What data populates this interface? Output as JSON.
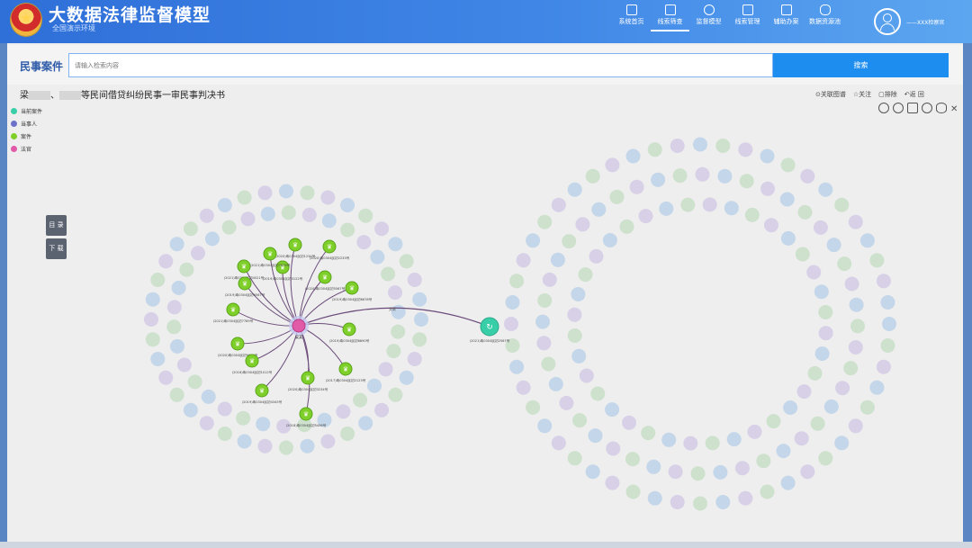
{
  "app": {
    "title": "大数据法律监督模型",
    "subtitle": "全国演示环境"
  },
  "nav": {
    "items": [
      {
        "label": "系统首页",
        "icon": "home-icon"
      },
      {
        "label": "线索筛查",
        "icon": "search-doc-icon",
        "active": true
      },
      {
        "label": "监督模型",
        "icon": "globe-icon"
      },
      {
        "label": "线索管理",
        "icon": "doc-icon"
      },
      {
        "label": "辅助办案",
        "icon": "grid-icon"
      },
      {
        "label": "数据资源池",
        "icon": "database-icon"
      }
    ]
  },
  "user": {
    "name": "XXX检察官"
  },
  "search": {
    "category": "民事案件",
    "placeholder": "请输入检索内容",
    "button": "搜索"
  },
  "case": {
    "title_prefix": "梁",
    "title_mid": "、",
    "title_suffix": "等民间借贷纠纷民事一审民事判决书"
  },
  "actions": {
    "related": "关联图谱",
    "follow": "关注",
    "exclude": "排除",
    "back": "返 回"
  },
  "legend": [
    {
      "label": "当前案件",
      "color": "#38cfa8"
    },
    {
      "label": "当事人",
      "color": "#6c72c9"
    },
    {
      "label": "案件",
      "color": "#7fcf2a"
    },
    {
      "label": "法官",
      "color": "#e05aa8"
    }
  ],
  "side": {
    "catalog": "目 录",
    "download": "下 载"
  },
  "graph": {
    "center_label": "梁某",
    "current_case_label": "(2021)粤0304民初2567号",
    "case_nodes": [
      {
        "label": "(2020)粤0304民初1234号"
      },
      {
        "label": "(2020)粤0304民初2233号"
      },
      {
        "label": "(2019)粤0304民初3122号"
      },
      {
        "label": "(2021)粤0304民初4521号"
      },
      {
        "label": "(2020)粤0304民初5567号"
      },
      {
        "label": "(2019)粤0304民初6678号"
      },
      {
        "label": "(2021)粤0304民初7789号"
      },
      {
        "label": "(2019)粤0304民初8890号"
      },
      {
        "label": "(2020)粤0304民初9901号"
      },
      {
        "label": "(2018)粤0304民初1012号"
      },
      {
        "label": "(2017)粤0304民初2123号"
      },
      {
        "label": "(2020)粤0304民初3234号"
      },
      {
        "label": "(2019)粤0304民初4345号"
      },
      {
        "label": "(2018)粤0304民初5456号"
      },
      {
        "label": "(2019)粤0304民初6567号"
      },
      {
        "label": "(2021)粤0304民初7678号"
      }
    ],
    "edge_label": "关联"
  },
  "colors": {
    "accent": "#1e8df0",
    "current": "#38cfa8",
    "party": "#6c72c9",
    "case": "#7fcf2a",
    "judge": "#e05aa8",
    "edge": "#6b4b7a"
  }
}
